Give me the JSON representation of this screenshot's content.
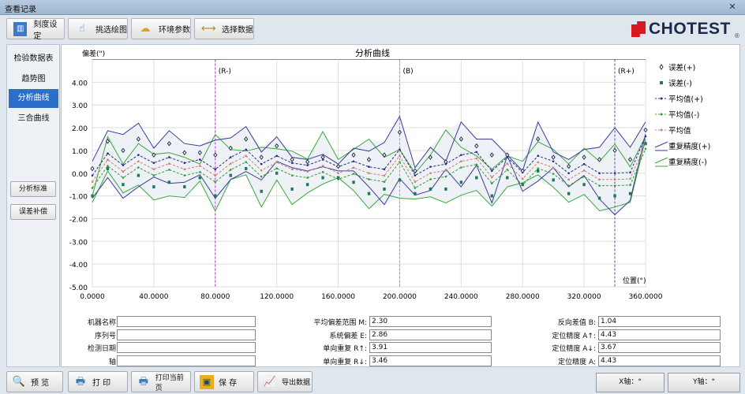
{
  "window": {
    "title": "查看记录",
    "close": "✕"
  },
  "toolbar": [
    {
      "label": "刻度设定",
      "icon": "ruler-icon"
    },
    {
      "label": "挑选绘图",
      "icon": "hand-pointer-icon"
    },
    {
      "label": "环境参数",
      "icon": "weather-icon"
    },
    {
      "label": "选择数据",
      "icon": "range-icon"
    }
  ],
  "logo": {
    "text": "CHOTEST",
    "mark": "®"
  },
  "sidebar": {
    "tabs": [
      "检验数据表",
      "趋势图",
      "分析曲线",
      "三合曲线"
    ],
    "active": 2,
    "buttons": [
      "分析标准",
      "误差补偿"
    ]
  },
  "colors": {
    "upper": "#3c3c9c",
    "lower": "#3aa83a",
    "mean_plus": "#2a2a8a",
    "mean_minus": "#3a9a3a",
    "mean": "#d08070",
    "err_plus": "#223355",
    "err_minus": "#1e7a5a",
    "r_marker": "#b040c0",
    "b_marker": "#999999",
    "fill": "#eef2f6",
    "active_tab": "#2c6fc9"
  },
  "chart_data": {
    "type": "line",
    "title": "分析曲线",
    "ylabel": "偏差(\")",
    "xlabel": "位置(°)",
    "xlim": [
      0,
      360
    ],
    "ylim": [
      -5,
      5
    ],
    "xticks": [
      "0.0000",
      "40.0000",
      "80.0000",
      "120.0000",
      "160.0000",
      "200.0000",
      "240.0000",
      "280.0000",
      "320.0000",
      "360.0000"
    ],
    "yticks": [
      "4.00",
      "3.00",
      "2.00",
      "1.00",
      "0.00",
      "-1.00",
      "-2.00",
      "-3.00",
      "-4.00",
      "-5.00"
    ],
    "grid": true,
    "legend": "right",
    "markers": [
      {
        "label": "(R-)",
        "x": 80
      },
      {
        "label": "(B)",
        "x": 200
      },
      {
        "label": "(R+)",
        "x": 340
      }
    ],
    "x": [
      0,
      10,
      20,
      30,
      40,
      50,
      60,
      70,
      80,
      90,
      100,
      110,
      120,
      130,
      140,
      150,
      160,
      170,
      180,
      190,
      200,
      210,
      220,
      230,
      240,
      250,
      260,
      270,
      280,
      290,
      300,
      310,
      320,
      330,
      340,
      350,
      360
    ],
    "series": [
      {
        "name": "误差(+)",
        "kind": "scatter-diamond",
        "values": [
          0.2,
          1.4,
          1.0,
          1.5,
          0.8,
          1.3,
          0.9,
          0.9,
          0.8,
          1.1,
          1.5,
          0.7,
          1.2,
          0.6,
          0.5,
          0.7,
          0.3,
          0.8,
          0.6,
          0.8,
          1.8,
          0.1,
          0.7,
          0.5,
          1.5,
          1.2,
          0.8,
          0.8,
          0.1,
          1.5,
          0.7,
          0.3,
          0.7,
          0.6,
          1.0,
          0.6,
          1.9
        ]
      },
      {
        "name": "误差(-)",
        "kind": "scatter-square",
        "values": [
          -1.0,
          0.2,
          -0.5,
          -0.1,
          -0.6,
          -0.4,
          -0.6,
          -0.2,
          -1.0,
          -0.1,
          0.2,
          -0.8,
          0,
          -0.7,
          -0.5,
          -0.2,
          -0.2,
          -0.4,
          -0.9,
          -0.7,
          -0.3,
          -0.9,
          -0.7,
          -0.7,
          -0.4,
          -0.2,
          -1.0,
          -0.2,
          -0.5,
          0.1,
          -0.3,
          -0.9,
          -0.5,
          -1.1,
          -1.0,
          -0.9,
          1.3
        ]
      },
      {
        "name": "平均值(+)",
        "kind": "dashed",
        "values": [
          -0.1,
          0.87,
          0.35,
          0.8,
          0.45,
          0.7,
          0.45,
          0.6,
          0.17,
          0.7,
          1.04,
          0.4,
          0.76,
          0.45,
          0.35,
          0.6,
          0.28,
          0.52,
          0.28,
          0.17,
          1.04,
          -0.1,
          0.28,
          0.4,
          0.8,
          0.93,
          0.1,
          0.7,
          0.03,
          0.76,
          0.52,
          0,
          0.4,
          0,
          0,
          0.03,
          1.62
        ]
      },
      {
        "name": "平均值(-)",
        "kind": "dashed",
        "values": [
          -0.65,
          0.32,
          -0.2,
          0.25,
          -0.1,
          0.15,
          -0.1,
          0.05,
          -0.38,
          0.15,
          0.49,
          -0.15,
          0.21,
          -0.1,
          -0.2,
          0.05,
          -0.27,
          -0.03,
          -0.27,
          -0.38,
          0.49,
          -0.65,
          -0.27,
          -0.15,
          0.25,
          0.38,
          -0.45,
          0.15,
          -0.52,
          0.21,
          -0.03,
          -0.55,
          -0.15,
          -0.55,
          -0.55,
          -0.52,
          1.07
        ]
      },
      {
        "name": "平均值",
        "kind": "dashed",
        "values": [
          -0.38,
          0.59,
          0.07,
          0.52,
          0.17,
          0.42,
          0.17,
          0.32,
          -0.11,
          0.42,
          0.76,
          0.12,
          0.48,
          0.17,
          0.07,
          0.32,
          0,
          0.24,
          0,
          -0.11,
          0.76,
          -0.38,
          0,
          0.12,
          0.52,
          0.65,
          -0.18,
          0.42,
          -0.25,
          0.48,
          0.24,
          -0.28,
          0.12,
          -0.28,
          -0.28,
          -0.25,
          1.34
        ]
      },
      {
        "name": "重复精度(+)",
        "kind": "solid-pair",
        "upper": [
          0.52,
          1.87,
          1.7,
          2.2,
          1.1,
          1.87,
          1.3,
          1.2,
          1.45,
          1.55,
          2.05,
          0.93,
          1.6,
          0.7,
          0.6,
          0.83,
          0.4,
          1.1,
          0.97,
          1.35,
          2.5,
          0.24,
          1.14,
          0.52,
          2.25,
          1.5,
          1.5,
          0.8,
          0.1,
          2.25,
          0.93,
          0.6,
          1.04,
          1.14,
          2.0,
          1.14,
          2.25
        ],
        "lower": [
          -1.1,
          -0.2,
          -1.1,
          -0.6,
          -0.17,
          -0.45,
          -0.4,
          -0.07,
          -1.1,
          -0.28,
          0.07,
          -0.3,
          0.52,
          0.24,
          0.1,
          0.28,
          0.1,
          0.1,
          -0.6,
          -1.38,
          -0.24,
          -0.97,
          -0.76,
          0.17,
          -0.6,
          0.35,
          -1.31,
          0.76,
          -0.8,
          -0.35,
          0.24,
          -0.6,
          -0.1,
          -1.14,
          -1.83,
          -1.2,
          1.73
        ]
      },
      {
        "name": "重复精度(-)",
        "kind": "solid-pair",
        "upper": [
          -1.0,
          1.6,
          0.4,
          1.3,
          0.83,
          0.9,
          0.7,
          0.4,
          1.7,
          1.04,
          0.97,
          1.14,
          1.07,
          0.97,
          0.62,
          1.83,
          0.6,
          1.04,
          1.5,
          0.7,
          1.04,
          0,
          0.8,
          1.9,
          1.14,
          0.76,
          0.17,
          0.76,
          0.52,
          1.38,
          1.04,
          0.4,
          1.1,
          0.52,
          1.28,
          0.28,
          1.62
        ],
        "lower": [
          -1.28,
          0.1,
          -0.87,
          -0.52,
          -1.18,
          -1.0,
          -1.07,
          -0.35,
          -1.66,
          -0.28,
          -0.07,
          -1.49,
          -0.3,
          -1.38,
          -0.87,
          -0.48,
          -0.2,
          -0.76,
          -1.56,
          -0.93,
          -1.1,
          -1.14,
          -1.04,
          -1.31,
          -0.97,
          -0.76,
          -1.45,
          -0.6,
          -0.42,
          -0.07,
          -0.62,
          -1.28,
          -0.93,
          -1.66,
          -1.49,
          -1.28,
          1.5
        ]
      }
    ]
  },
  "fields": {
    "left": [
      {
        "label": "机器名称:",
        "value": ""
      },
      {
        "label": "序列号:",
        "value": ""
      },
      {
        "label": "检测日期:",
        "value": ""
      },
      {
        "label": "轴:",
        "value": ""
      }
    ],
    "middle": [
      {
        "label": "平均偏差范围 M:",
        "value": "2.30"
      },
      {
        "label": "系统偏差 E:",
        "value": "2.86"
      },
      {
        "label": "单向重复 R↑:",
        "value": "3.91"
      },
      {
        "label": "单向重复 R↓:",
        "value": "3.46"
      }
    ],
    "right": [
      {
        "label": "反向差值 B:",
        "value": "1.04"
      },
      {
        "label": "定位精度 A↑:",
        "value": "4.43"
      },
      {
        "label": "定位精度 A↓:",
        "value": "3.67"
      },
      {
        "label": "定位精度 A:",
        "value": "4.43"
      }
    ]
  },
  "bottom": {
    "buttons": [
      {
        "label": "预 览",
        "icon": "search-icon"
      },
      {
        "label": "打 印",
        "icon": "printer-icon"
      },
      {
        "label": "打印当前页",
        "icon": "printer-icon"
      },
      {
        "label": "保 存",
        "icon": "floppy-icon"
      },
      {
        "label": "导出数据",
        "icon": "export-chart-icon"
      }
    ],
    "x_axis": "X轴：°",
    "y_axis": "Y轴：\""
  }
}
